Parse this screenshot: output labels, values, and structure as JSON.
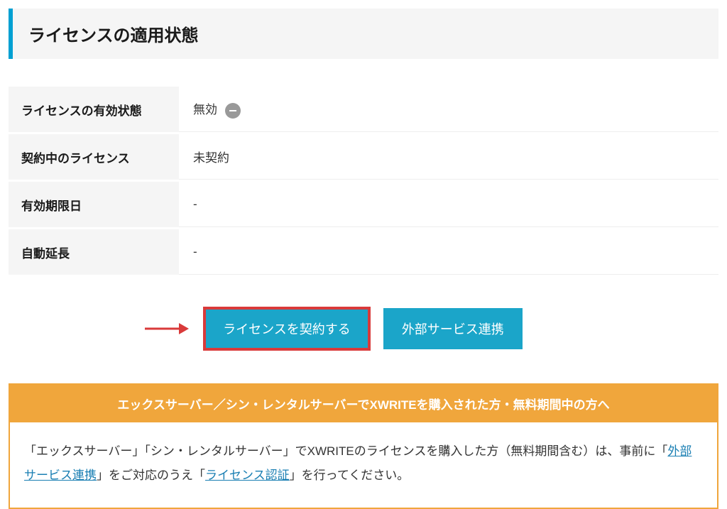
{
  "section": {
    "title": "ライセンスの適用状態"
  },
  "status": {
    "rows": [
      {
        "label": "ライセンスの有効状態",
        "value": "無効",
        "badge": true
      },
      {
        "label": "契約中のライセンス",
        "value": "未契約",
        "badge": false
      },
      {
        "label": "有効期限日",
        "value": "-",
        "badge": false
      },
      {
        "label": "自動延長",
        "value": "-",
        "badge": false
      }
    ]
  },
  "buttons": {
    "contract": "ライセンスを契約する",
    "external": "外部サービス連携"
  },
  "notice": {
    "header": "エックスサーバー／シン・レンタルサーバーでXWRITEを購入された方・無料期間中の方へ",
    "body_parts": {
      "p1": "「エックスサーバー」「シン・レンタルサーバー」でXWRITEのライセンスを購入した方（無料期間含む）は、事前に「",
      "link1": "外部サービス連携",
      "p2": "」をご対応のうえ「",
      "link2": "ライセンス認証",
      "p3": "」を行ってください。"
    }
  },
  "annotation": {
    "arrow_color": "#d93a3a"
  }
}
